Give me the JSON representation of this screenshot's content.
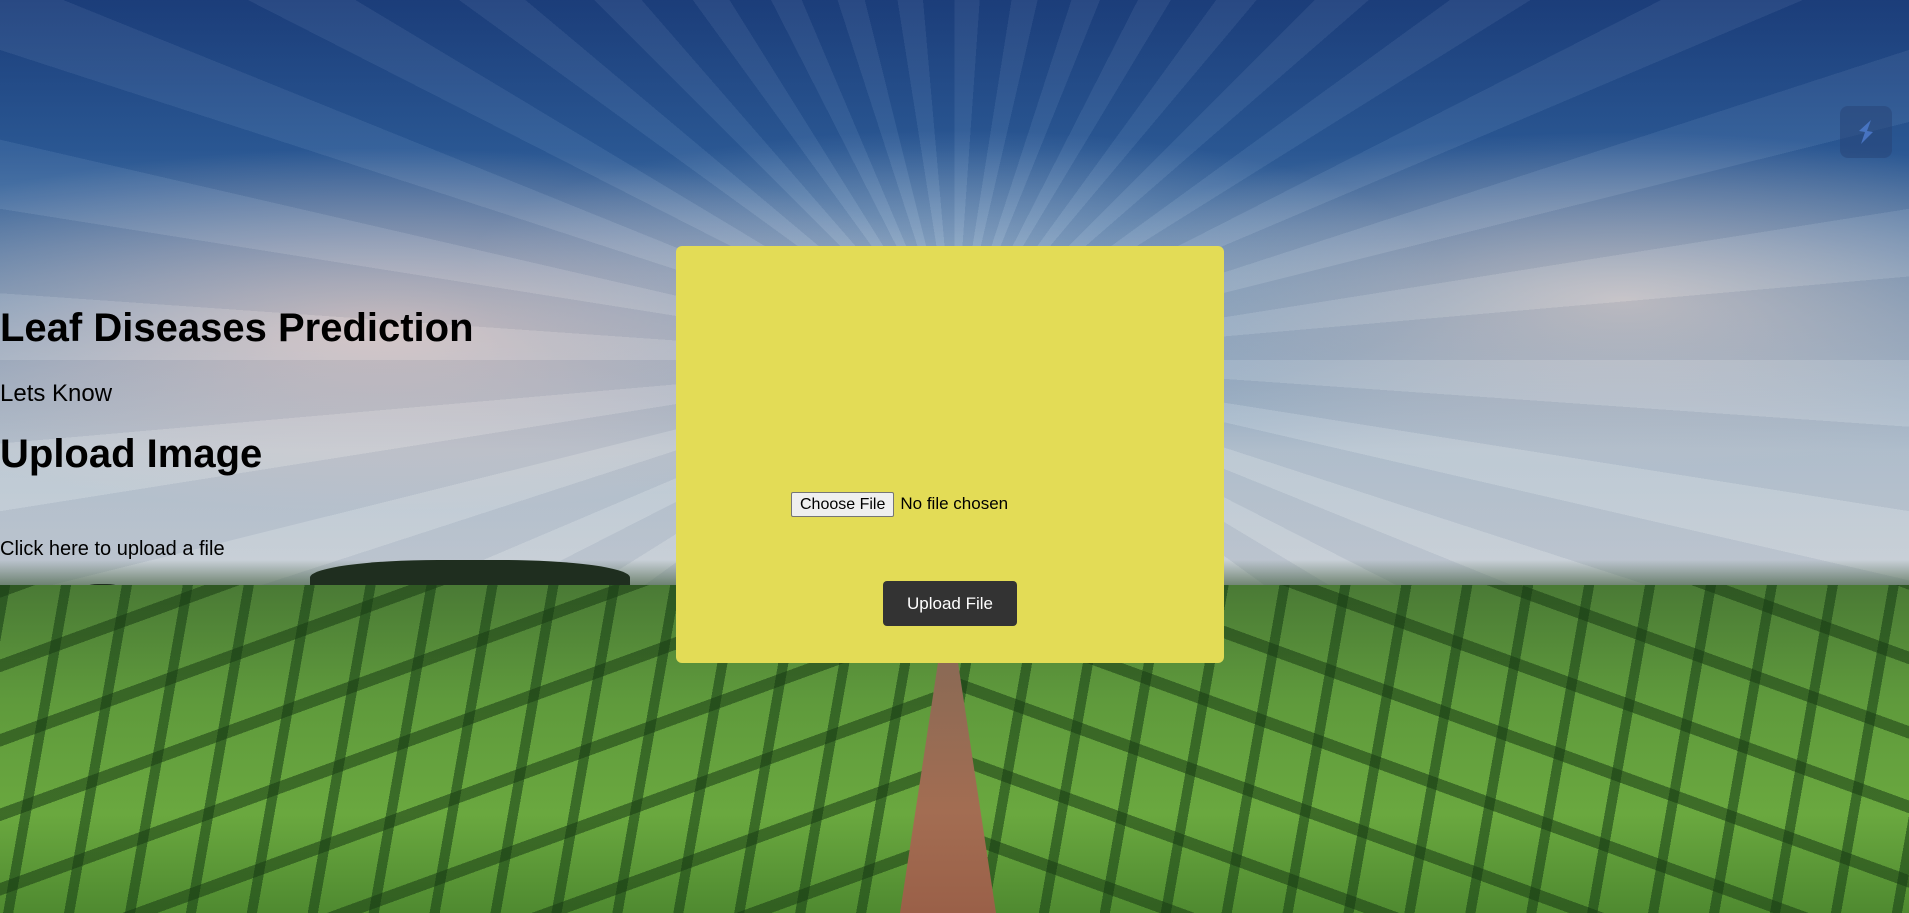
{
  "card": {
    "title": "Leaf Diseases Prediction",
    "subtitle": "Lets Know",
    "upload_heading": "Upload Image",
    "choose_file_label": "Choose File",
    "no_file_text": "No file chosen",
    "hint": "Click here to upload a file",
    "upload_button_label": "Upload File"
  },
  "extension": {
    "icon": "extension-icon"
  },
  "colors": {
    "card_background": "#e3dc56",
    "upload_button_background": "#333333",
    "upload_button_text": "#ffffff"
  }
}
